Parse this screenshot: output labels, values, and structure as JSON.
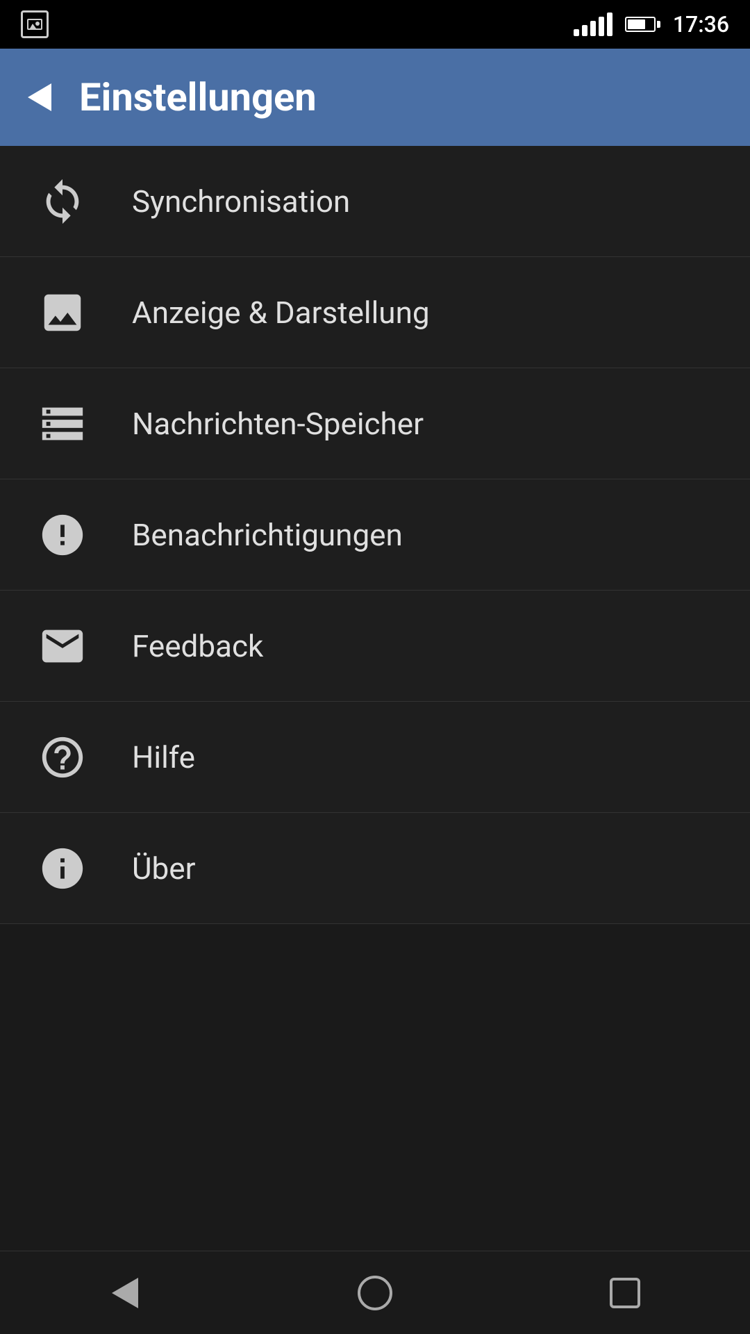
{
  "statusBar": {
    "time": "17:36"
  },
  "appBar": {
    "backLabel": "Back",
    "title": "Einstellungen"
  },
  "menuItems": [
    {
      "id": "synchronisation",
      "icon": "sync-icon",
      "label": "Synchronisation"
    },
    {
      "id": "anzeige-darstellung",
      "icon": "image-icon",
      "label": "Anzeige & Darstellung"
    },
    {
      "id": "nachrichten-speicher",
      "icon": "storage-icon",
      "label": "Nachrichten-Speicher"
    },
    {
      "id": "benachrichtigungen",
      "icon": "notification-icon",
      "label": "Benachrichtigungen"
    },
    {
      "id": "feedback",
      "icon": "feedback-icon",
      "label": "Feedback"
    },
    {
      "id": "hilfe",
      "icon": "help-icon",
      "label": "Hilfe"
    },
    {
      "id": "ueber",
      "icon": "info-icon",
      "label": "Über"
    }
  ],
  "bottomNav": {
    "backLabel": "Back",
    "homeLabel": "Home",
    "recentLabel": "Recent"
  }
}
